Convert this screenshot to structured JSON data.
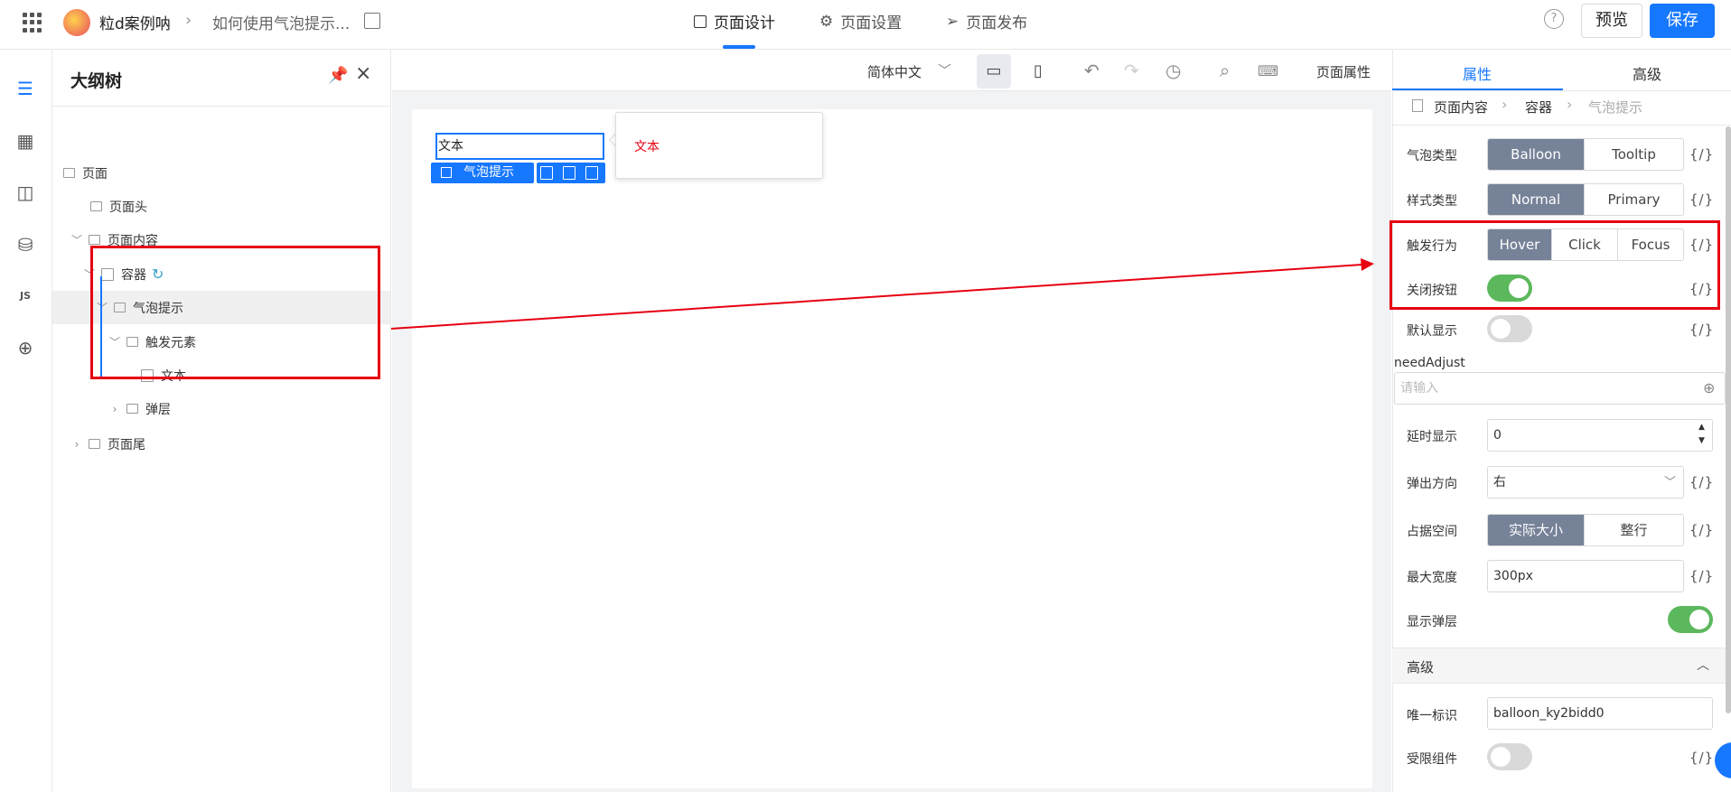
{
  "topbar": {
    "app_name": "粒d案例呐",
    "breadcrumb_sep": "›",
    "doc_name": "如何使用气泡提示...",
    "tabs": [
      {
        "label": "页面设计",
        "icon": "layout-icon"
      },
      {
        "label": "页面设置",
        "icon": "gear-icon"
      },
      {
        "label": "页面发布",
        "icon": "send-icon"
      }
    ],
    "active_tab": "页面设计",
    "help": "?",
    "preview_label": "预览",
    "save_label": "保存"
  },
  "outline": {
    "title": "大纲树",
    "nodes": [
      {
        "label": "页面"
      },
      {
        "label": "页面头"
      },
      {
        "label": "页面内容"
      },
      {
        "label": "容器"
      },
      {
        "label": "气泡提示"
      },
      {
        "label": "触发元素"
      },
      {
        "label": "文本"
      },
      {
        "label": "弹层"
      },
      {
        "label": "页面尾"
      }
    ],
    "selected": "气泡提示"
  },
  "canvas_toolbar": {
    "language": "简体中文",
    "page_props_label": "页面属性"
  },
  "canvas": {
    "text_component": "文本",
    "selected_tag": "气泡提示",
    "balloon_text": "文本"
  },
  "props": {
    "tabs": [
      "属性",
      "高级"
    ],
    "active_tab": "属性",
    "breadcrumb": [
      "页面内容",
      "容器",
      "气泡提示"
    ],
    "balloon_type": {
      "label": "气泡类型",
      "options": [
        "Balloon",
        "Tooltip"
      ],
      "selected": "Balloon"
    },
    "style_type": {
      "label": "样式类型",
      "options": [
        "Normal",
        "Primary"
      ],
      "selected": "Normal"
    },
    "trigger": {
      "label": "触发行为",
      "options": [
        "Hover",
        "Click",
        "Focus"
      ],
      "selected": "Hover"
    },
    "close_button": {
      "label": "关闭按钮",
      "on": true
    },
    "default_visible": {
      "label": "默认显示",
      "on": false
    },
    "need_adjust": {
      "label": "needAdjust",
      "placeholder": "请输入"
    },
    "delay": {
      "label": "延时显示",
      "value": "0"
    },
    "direction": {
      "label": "弹出方向",
      "value": "右"
    },
    "space": {
      "label": "占据空间",
      "options": [
        "实际大小",
        "整行"
      ],
      "selected": "实际大小"
    },
    "max_width": {
      "label": "最大宽度",
      "value": "300px"
    },
    "show_popup": {
      "label": "显示弹层",
      "on": true
    },
    "advanced_section": "高级",
    "unique_id": {
      "label": "唯一标识",
      "value": "balloon_ky2bidd0"
    },
    "restricted": {
      "label": "受限组件",
      "on": false
    },
    "var_binding": "{/}"
  },
  "colors": {
    "accent": "#1677ff",
    "annotation_red": "#e60012",
    "toggle_on": "#5cb85c",
    "segment_selected": "#768298"
  }
}
